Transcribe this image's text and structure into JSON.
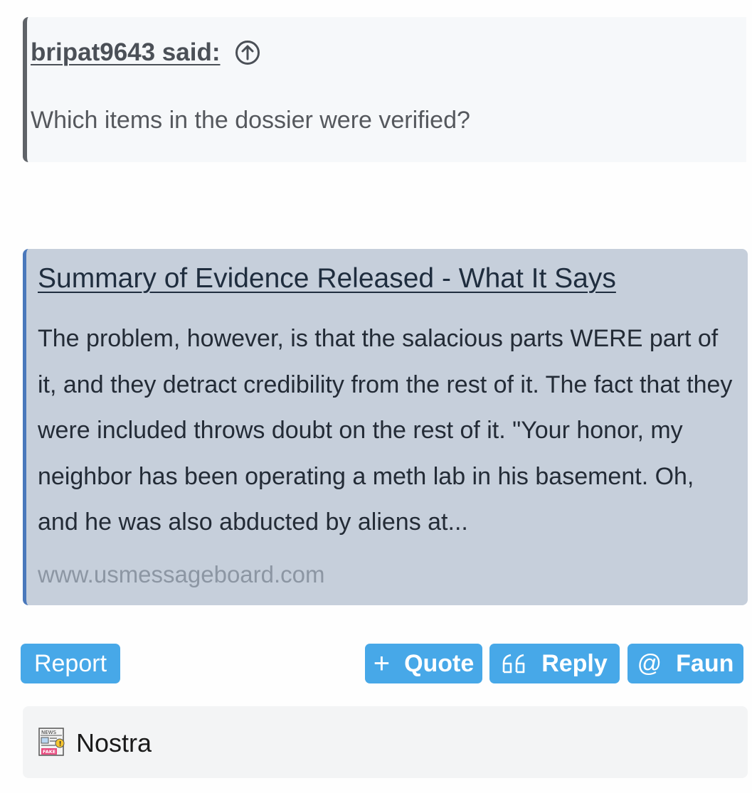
{
  "quote": {
    "author": "bripat9643 said:",
    "text": "Which items in the dossier were verified?",
    "arrow_icon": "arrow-up-circle-icon"
  },
  "link_card": {
    "title": "Summary of Evidence Released - What It Says",
    "excerpt": "The problem, however, is that the salacious parts WERE part of it, and they detract credibility from the rest of it. The fact that they were included throws doubt on the rest of it. \"Your honor, my neighbor has been operating a meth lab in his basement. Oh, and he was also abducted by aliens at...",
    "domain": "www.usmessageboard.com"
  },
  "actions": {
    "report_label": "Report",
    "quote_label": "Quote",
    "quote_icon": "+",
    "reply_label": "Reply",
    "reply_icon": "66",
    "mention_label": "Faun",
    "mention_icon": "@"
  },
  "signature": {
    "text": "Nostra",
    "icon": "fake-news-icon",
    "icon_top_label": "NEWS",
    "icon_bottom_label": "FAKE"
  },
  "colors": {
    "button_bg": "#47a8e8",
    "card_bg": "#c6cfdb",
    "card_border": "#4a78bb",
    "quote_border": "#5f6368"
  }
}
